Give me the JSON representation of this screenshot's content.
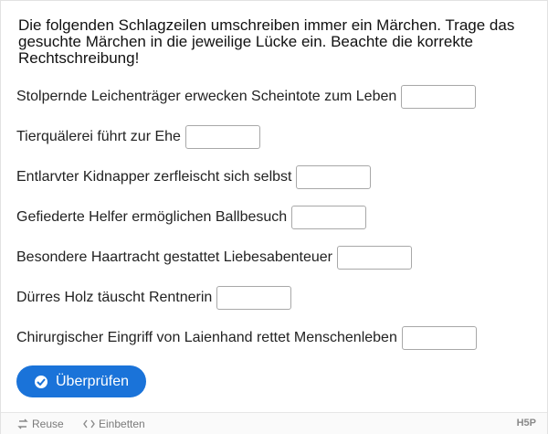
{
  "instructions": "Die folgenden Schlagzeilen umschreiben immer ein Märchen. Trage das gesuchte Märchen in die jeweilige Lücke ein. Beachte die korrekte Rechtschreibung!",
  "items": [
    {
      "label": "Stolpernde Leichenträger erwecken Scheintote zum Leben",
      "value": ""
    },
    {
      "label": "Tierquälerei führt zur Ehe",
      "value": ""
    },
    {
      "label": "Entlarvter Kidnapper zerfleischt sich selbst",
      "value": ""
    },
    {
      "label": "Gefiederte Helfer ermöglichen Ballbesuch",
      "value": ""
    },
    {
      "label": "Besondere Haartracht gestattet Liebesabenteuer",
      "value": ""
    },
    {
      "label": "Dürres Holz täuscht Rentnerin",
      "value": ""
    },
    {
      "label": "Chirurgischer Eingriff von Laienhand rettet Menschenleben",
      "value": ""
    }
  ],
  "check_button": {
    "label": "Überprüfen",
    "icon": "check-circle-icon",
    "color": "#1a73d9"
  },
  "footer": {
    "reuse_label": "Reuse",
    "embed_label": "Einbetten",
    "logo": "H5P"
  }
}
